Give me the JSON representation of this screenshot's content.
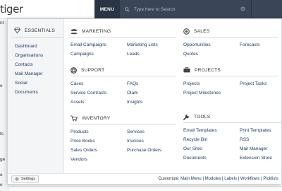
{
  "topbar": {
    "logo": "tiger",
    "menu_label": "MENU",
    "search_placeholder": "Type here to Search"
  },
  "background": {
    "fragments": [
      "nt",
      "e",
      "ts",
      "ge",
      "e",
      "e"
    ]
  },
  "essentials": {
    "title": "ESSENTIALS",
    "items": [
      "Dashboard",
      "Organisations",
      "Contacts",
      "Mail Manager",
      "Social",
      "Documents"
    ]
  },
  "sections": {
    "marketing": {
      "title": "MARKETING",
      "items": [
        "Email Campaigns",
        "Marketing Lists",
        "Campaigns",
        "Leads"
      ]
    },
    "sales": {
      "title": "SALES",
      "items": [
        "Opportunities",
        "Forecasts",
        "Quotes"
      ]
    },
    "support": {
      "title": "SUPPORT",
      "items": [
        "Cases",
        "FAQs",
        "Service Contracts",
        "Olark",
        "Assets",
        "Insights"
      ]
    },
    "projects": {
      "title": "PROJECTS",
      "items": [
        "Projects",
        "Project Tasks",
        "Project Milestones"
      ]
    },
    "inventory": {
      "title": "INVENTORY",
      "items": [
        "Products",
        "Services",
        "Price Books",
        "Invoices",
        "Sales Orders",
        "Purchase Orders",
        "Vendors"
      ]
    },
    "tools": {
      "title": "TOOLS",
      "items": [
        "Email Templates",
        "Print Templates",
        "Recycle Bin",
        "RSS",
        "Our Sites",
        "Mail Manager",
        "Documents",
        "Extension Store"
      ]
    }
  },
  "footer": {
    "settings_label": "Settings",
    "customize_prefix": "Customize:",
    "links": [
      "Main Menu",
      "Modules",
      "Labels",
      "Workflows",
      "Picklists"
    ]
  }
}
